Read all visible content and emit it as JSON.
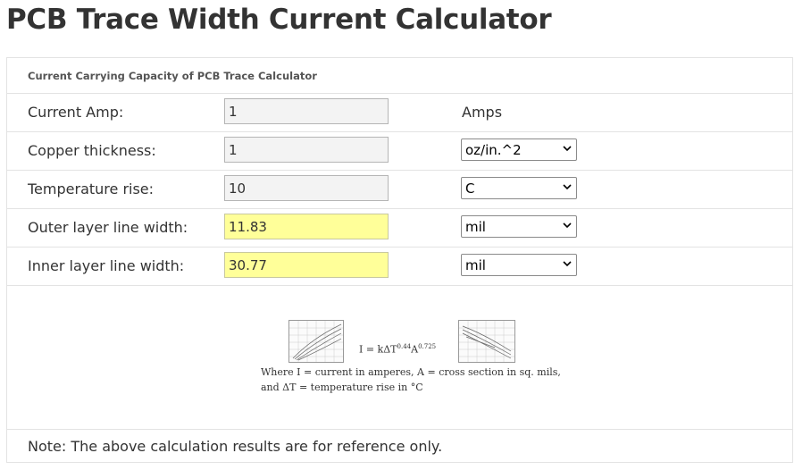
{
  "page": {
    "title": "PCB Trace Width Current Calculator"
  },
  "calculator": {
    "header": "Current Carrying Capacity of PCB Trace Calculator",
    "rows": [
      {
        "label": "Current Amp:",
        "value": "1",
        "unit": "Amps"
      },
      {
        "label": "Copper thickness:",
        "value": "1",
        "unit": "oz/in.^2"
      },
      {
        "label": "Temperature rise:",
        "value": "10",
        "unit": "C"
      },
      {
        "label": "Outer layer line width:",
        "value": "11.83",
        "unit": "mil"
      },
      {
        "label": "Inner layer line width:",
        "value": "30.77",
        "unit": "mil"
      }
    ],
    "formula": {
      "base": "I = kΔT",
      "exp1": "0.44",
      "mid": "A",
      "exp2": "0.725",
      "line1": "Where I = current in amperes, A = cross section in sq. mils,",
      "line2": "and ΔT = temperature rise in °C"
    },
    "note": "Note: The above calculation results are for reference only."
  },
  "colors": {
    "result_bg": "#ffff99",
    "input_bg": "#f3f3f3",
    "border": "#e3e3e3"
  },
  "icons": {
    "dropdown": "chevron-down-icon"
  }
}
